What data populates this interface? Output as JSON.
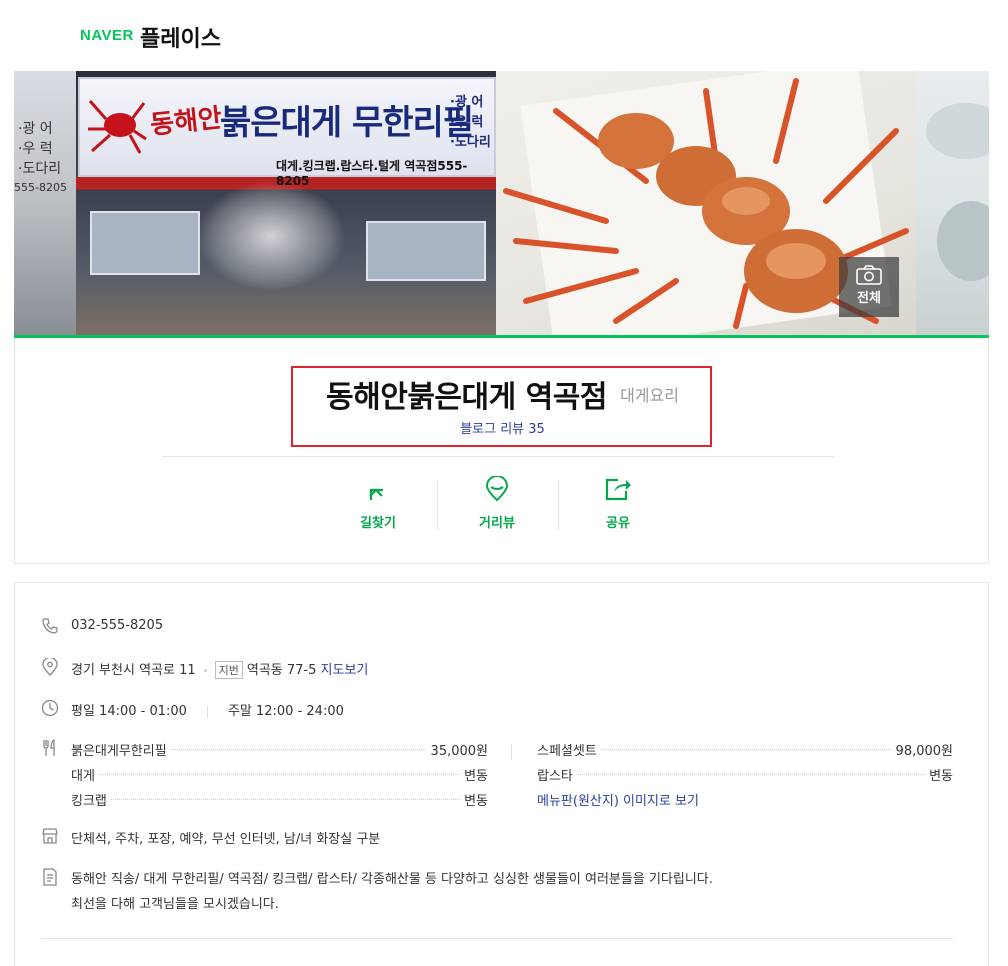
{
  "header": {
    "brand": "NAVER",
    "title": "플레이스"
  },
  "gallery": {
    "left_sign_text": [
      "·광 어",
      "·우 럭",
      "·도다리"
    ],
    "left_sign_number": "555-8205",
    "main_sign": {
      "brand": "동해안",
      "main": "붉은대게 무한리필",
      "side": [
        "·광 어",
        "·우 럭",
        "·도다리"
      ],
      "sub": "대게.킹크랩.랍스타.털게   역곡점555-8205"
    },
    "all_photos_label": "전체"
  },
  "store": {
    "name": "동해안붉은대게 역곡점",
    "category": "대게요리",
    "review_link": "블로그 리뷰 35"
  },
  "actions": [
    {
      "label": "길찾기",
      "icon": "directions-icon"
    },
    {
      "label": "거리뷰",
      "icon": "street-view-icon"
    },
    {
      "label": "공유",
      "icon": "share-icon"
    }
  ],
  "details": {
    "phone": "032-555-8205",
    "address": "경기 부천시 역곡로 11",
    "jibun_tag": "지번",
    "jibun": "역곡동 77-5",
    "map_link": "지도보기",
    "hours_weekday": "평일 14:00 - 01:00",
    "hours_weekend": "주말 12:00 - 24:00",
    "menu": [
      {
        "name": "붉은대게무한리필",
        "price": "35,000원"
      },
      {
        "name": "스페셜셋트",
        "price": "98,000원"
      },
      {
        "name": "대게",
        "price": "변동"
      },
      {
        "name": "랍스타",
        "price": "변동"
      },
      {
        "name": "킹크랩",
        "price": "변동"
      }
    ],
    "menu_board_link": "메뉴판(원산지) 이미지로 보기",
    "facilities": "단체석, 주차, 포장, 예약, 무선 인터넷, 남/녀 화장실 구분",
    "description": [
      "동해안 직송/ 대게 무한리필/ 역곡점/ 킹크랩/ 랍스타/ 각종해산물 등 다양하고 싱싱한 생물들이 여러분들을 기다립니다.",
      "최선을 다해 고객님들을 모시겠습니다."
    ]
  },
  "colors": {
    "naver_green": "#03c75a",
    "link_blue": "#2b3fa0",
    "highlight_red": "#e0242f"
  }
}
